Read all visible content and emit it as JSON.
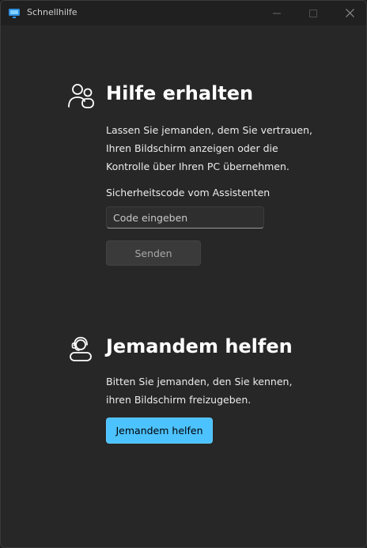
{
  "window": {
    "title": "Schnellhilfe",
    "app_icon": "quick-assist-icon",
    "caption_buttons": {
      "minimize_icon": "minimize-icon",
      "maximize_icon": "maximize-icon",
      "close_icon": "close-icon"
    }
  },
  "get_help": {
    "icon": "people-icon",
    "heading": "Hilfe erhalten",
    "description": "Lassen Sie jemanden, dem Sie vertrauen,\nIhren Bildschirm anzeigen oder die\nKontrolle über Ihren PC übernehmen.",
    "code_label": "Sicherheitscode vom Assistenten",
    "code_input": {
      "value": "",
      "placeholder": "Code eingeben"
    },
    "submit_label": "Senden"
  },
  "give_help": {
    "icon": "headset-person-icon",
    "heading": "Jemandem helfen",
    "description": "Bitten Sie jemanden, den Sie kennen,\nihren Bildschirm freizugeben.",
    "button_label": "Jemandem helfen"
  },
  "colors": {
    "accent": "#4cc2ff",
    "background": "#272727",
    "titlebar": "#202020"
  }
}
